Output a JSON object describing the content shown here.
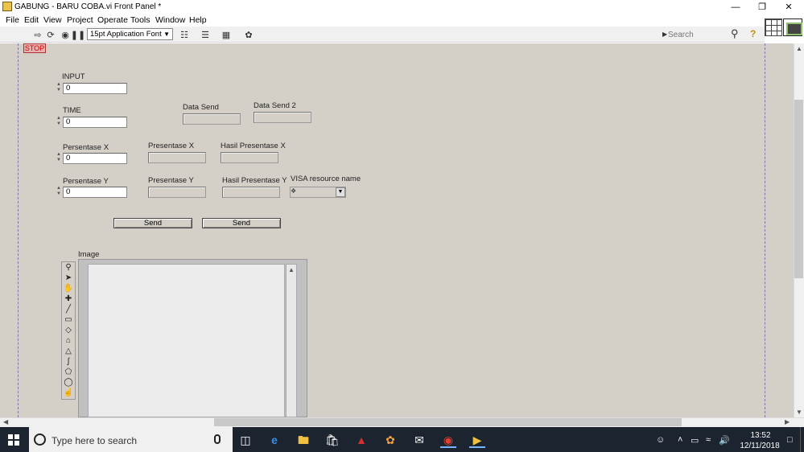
{
  "window": {
    "title": "GABUNG - BARU COBA.vi Front Panel *",
    "minimize_icon": "minimize-icon",
    "restore_icon": "restore-icon",
    "close_icon": "close-icon"
  },
  "menu": [
    "File",
    "Edit",
    "View",
    "Project",
    "Operate",
    "Tools",
    "Window",
    "Help"
  ],
  "toolbar": {
    "font": "15pt Application Font",
    "search_placeholder": "Search"
  },
  "panel": {
    "stop_label": "STOP",
    "input_label": "INPUT",
    "input_value": "0",
    "time_label": "TIME",
    "time_value": "0",
    "data_send_label": "Data Send",
    "data_send2_label": "Data Send 2",
    "persen_x_ctrl_label": "Persentase X",
    "persen_x_ctrl_value": "0",
    "presen_x_ind_label": "Presentase X",
    "hasil_x_label": "Hasil Presentase X",
    "persen_y_ctrl_label": "Persentase Y",
    "persen_y_ctrl_value": "0",
    "presen_y_ind_label": "Presentase Y",
    "hasil_y_label": "Hasil Presentase Y",
    "visa_label": "VISA resource name",
    "send1_label": "Send",
    "send2_label": "Send",
    "image_label": "Image"
  },
  "taskbar": {
    "search_text": "Type here to search",
    "time": "13:52",
    "date": "12/11/2018"
  },
  "colors": {
    "panel_bg": "#d4d0c8",
    "stop_bg": "#e9b0b0",
    "taskbar_bg": "#1c2430"
  }
}
